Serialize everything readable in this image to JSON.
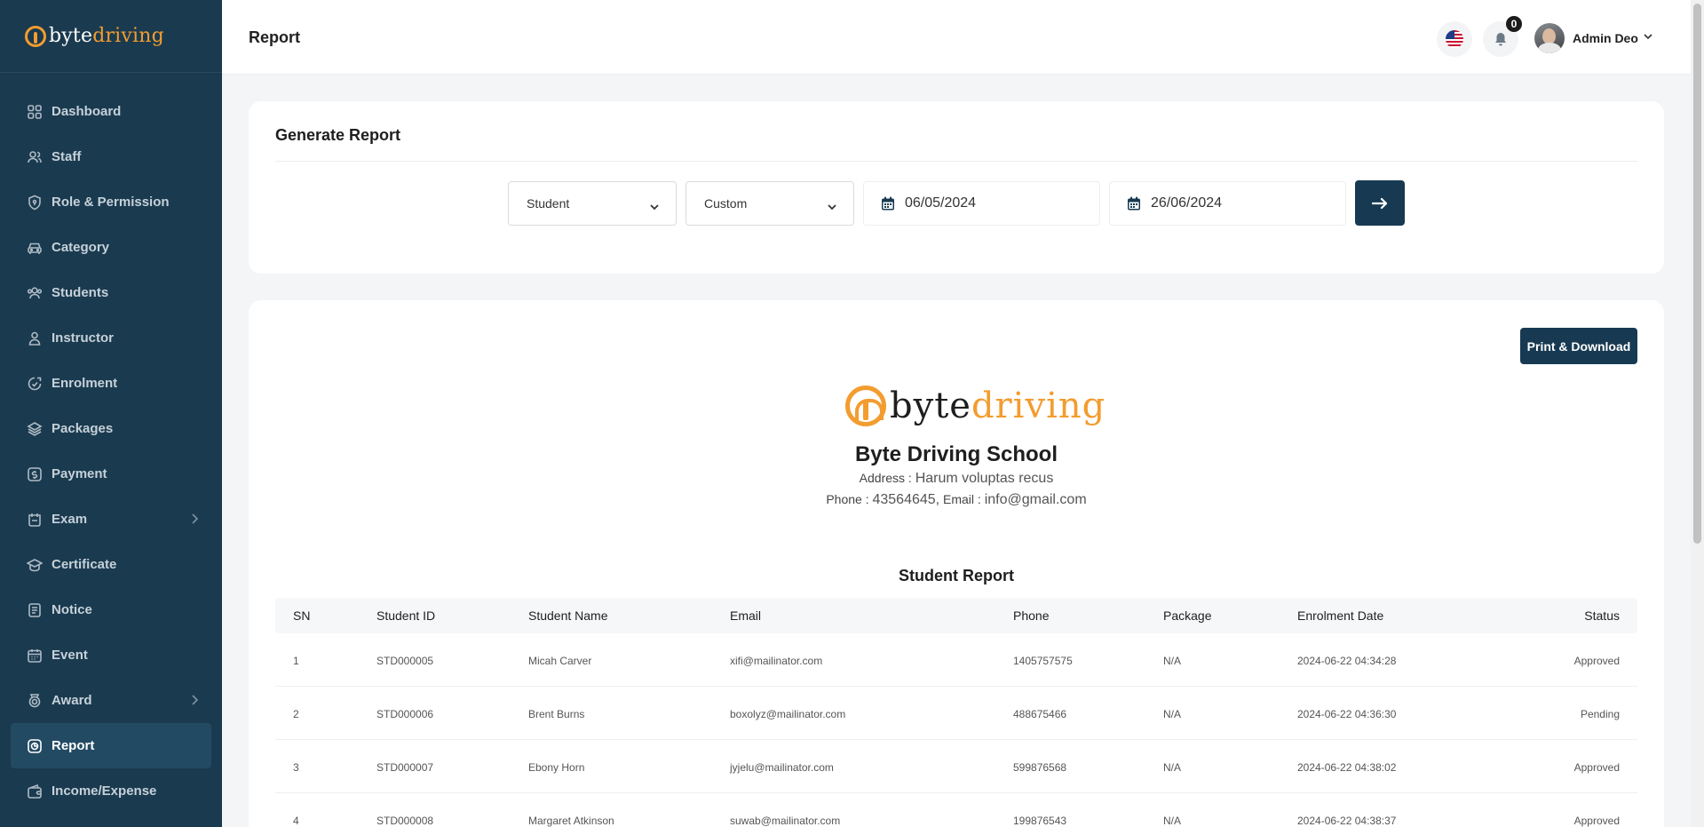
{
  "brand": {
    "part1": "byte",
    "part2": "driving"
  },
  "sidebar": {
    "items": [
      {
        "label": "Dashboard",
        "icon": "dashboard-icon"
      },
      {
        "label": "Staff",
        "icon": "users-icon"
      },
      {
        "label": "Role & Permission",
        "icon": "shield-icon"
      },
      {
        "label": "Category",
        "icon": "car-icon"
      },
      {
        "label": "Students",
        "icon": "students-icon"
      },
      {
        "label": "Instructor",
        "icon": "user-icon"
      },
      {
        "label": "Enrolment",
        "icon": "enrolment-icon"
      },
      {
        "label": "Packages",
        "icon": "layers-icon"
      },
      {
        "label": "Payment",
        "icon": "dollar-icon"
      },
      {
        "label": "Exam",
        "icon": "exam-icon",
        "has_submenu": true
      },
      {
        "label": "Certificate",
        "icon": "graduation-cap-icon"
      },
      {
        "label": "Notice",
        "icon": "notice-icon"
      },
      {
        "label": "Event",
        "icon": "calendar-icon"
      },
      {
        "label": "Award",
        "icon": "award-icon",
        "has_submenu": true
      },
      {
        "label": "Report",
        "icon": "report-icon",
        "active": true
      },
      {
        "label": "Income/Expense",
        "icon": "wallet-icon"
      }
    ]
  },
  "header": {
    "title": "Report",
    "notification_count": "0",
    "user_name": "Admin Deo",
    "language_icon": "us-flag-icon"
  },
  "generate": {
    "title": "Generate Report",
    "type_select": "Student",
    "range_select": "Custom",
    "date_from": "06/05/2024",
    "date_to": "26/06/2024"
  },
  "report": {
    "print_label": "Print & Download",
    "school_name": "Byte Driving School",
    "address_label": "Address :",
    "address_value": "Harum voluptas recus",
    "phone_label": "Phone :",
    "phone_value": "43564645,",
    "email_label": "Email :",
    "email_value": "info@gmail.com",
    "title": "Student Report",
    "columns": [
      "SN",
      "Student ID",
      "Student Name",
      "Email",
      "Phone",
      "Package",
      "Enrolment Date",
      "Status"
    ],
    "rows": [
      [
        "1",
        "STD000005",
        "Micah Carver",
        "xifi@mailinator.com",
        "1405757575",
        "N/A",
        "2024-06-22 04:34:28",
        "Approved"
      ],
      [
        "2",
        "STD000006",
        "Brent Burns",
        "boxolyz@mailinator.com",
        "488675466",
        "N/A",
        "2024-06-22 04:36:30",
        "Pending"
      ],
      [
        "3",
        "STD000007",
        "Ebony Horn",
        "jyjelu@mailinator.com",
        "599876568",
        "N/A",
        "2024-06-22 04:38:02",
        "Approved"
      ],
      [
        "4",
        "STD000008",
        "Margaret Atkinson",
        "suwab@mailinator.com",
        "199876543",
        "N/A",
        "2024-06-22 04:38:37",
        "Approved"
      ]
    ]
  },
  "colors": {
    "sidebar_bg": "#1a3a4f",
    "accent": "#f39c2f",
    "button_bg": "#173a52"
  }
}
